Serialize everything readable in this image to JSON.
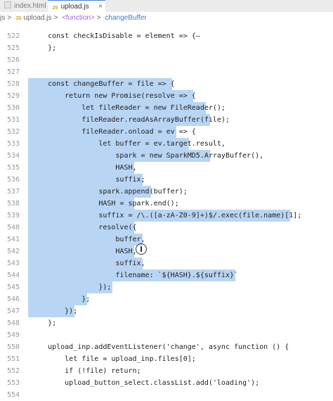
{
  "tabs": [
    {
      "label": "index.html",
      "active": false
    },
    {
      "label": "upload.js",
      "active": true,
      "close": "×"
    }
  ],
  "breadcrumb": {
    "folder": "js",
    "sep": ">",
    "file_icon": "JS",
    "file": "upload.js",
    "fn": "<function>",
    "fn2": "changeBuffer"
  },
  "lines": [
    {
      "n": "522",
      "t": "    const checkIsDisable = element => {—"
    },
    {
      "n": "525",
      "t": "    };"
    },
    {
      "n": "526",
      "t": ""
    },
    {
      "n": "527",
      "t": ""
    },
    {
      "n": "528",
      "t": "    const changeBuffer = file => {"
    },
    {
      "n": "529",
      "t": "        return new Promise(resolve => {"
    },
    {
      "n": "530",
      "t": "            let fileReader = new FileReader();"
    },
    {
      "n": "531",
      "t": "            fileReader.readAsArrayBuffer(file);"
    },
    {
      "n": "532",
      "t": "            fileReader.onload = ev => {"
    },
    {
      "n": "533",
      "t": "                let buffer = ev.target.result,"
    },
    {
      "n": "534",
      "t": "                    spark = new SparkMD5.ArrayBuffer(),"
    },
    {
      "n": "535",
      "t": "                    HASH,"
    },
    {
      "n": "536",
      "t": "                    suffix;"
    },
    {
      "n": "537",
      "t": "                spark.append(buffer);"
    },
    {
      "n": "538",
      "t": "                HASH = spark.end();"
    },
    {
      "n": "539",
      "t": "                suffix = /\\.([a-zA-Z0-9]+)$/.exec(file.name)[1];"
    },
    {
      "n": "540",
      "t": "                resolve({"
    },
    {
      "n": "541",
      "t": "                    buffer,"
    },
    {
      "n": "542",
      "t": "                    HASH,"
    },
    {
      "n": "543",
      "t": "                    suffix,"
    },
    {
      "n": "544",
      "t": "                    filename: `${HASH}.${suffix}`"
    },
    {
      "n": "545",
      "t": "                });"
    },
    {
      "n": "546",
      "t": "            };"
    },
    {
      "n": "547",
      "t": "        });"
    },
    {
      "n": "548",
      "t": "    };"
    },
    {
      "n": "549",
      "t": ""
    },
    {
      "n": "550",
      "t": "    upload_inp.addEventListener('change', async function () {"
    },
    {
      "n": "551",
      "t": "        let file = upload_inp.files[0];"
    },
    {
      "n": "552",
      "t": "        if (!file) return;"
    },
    {
      "n": "553",
      "t": "        upload_button_select.classList.add('loading');"
    },
    {
      "n": "554",
      "t": ""
    }
  ]
}
